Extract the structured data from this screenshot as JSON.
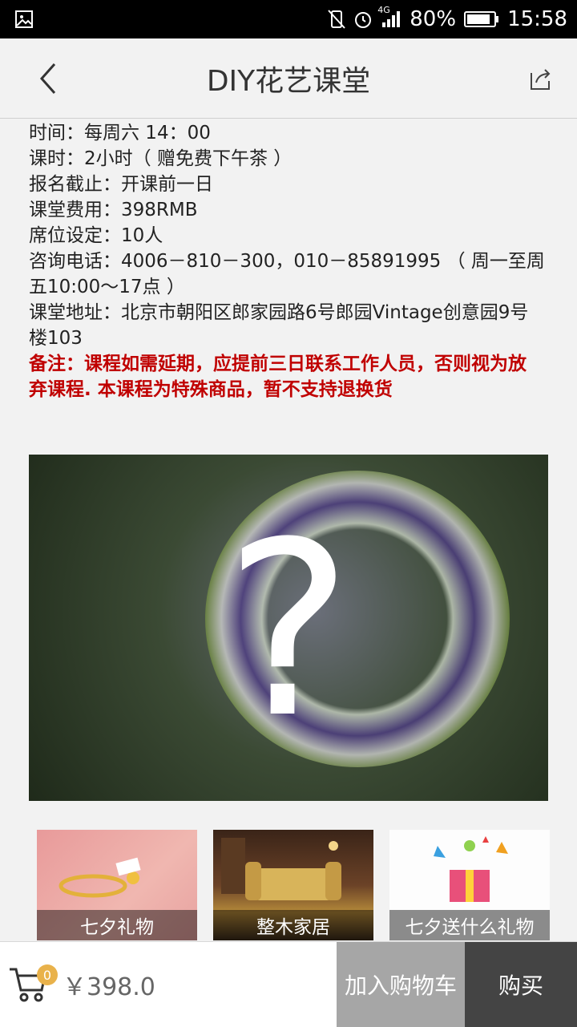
{
  "status_bar": {
    "network": "4G",
    "battery": "80%",
    "time": "15:58",
    "icons": [
      "image-icon",
      "vibrate-icon",
      "alarm-icon",
      "signal-icon",
      "battery-icon"
    ]
  },
  "header": {
    "title": "DIY花艺课堂",
    "back_icon": "back-arrow-icon",
    "share_icon": "share-icon"
  },
  "details": {
    "time": "时间：每周六 14：00",
    "duration": "课时：2小时（ 赠免费下午茶 ）",
    "deadline": "报名截止：开课前一日",
    "fee": "课堂费用：398RMB",
    "seats": "席位设定：10人",
    "phone_line1": "咨询电话：4006－810－300，010－85891995 （ 周一至周",
    "phone_line2": "五10:00～17点 ）",
    "address_line1": "课堂地址：北京市朝阳区郎家园路6号郎园Vintage创意园9号",
    "address_line2": "楼103",
    "note_line1": "备注：课程如需延期，应提前三日联系工作人员，否则视为放",
    "note_line2": "弃课程. 本课程为特殊商品，暂不支持退换货"
  },
  "hero": {
    "overlay_symbol": "?"
  },
  "related": [
    {
      "label": "七夕礼物",
      "icon": "gift-ring-image"
    },
    {
      "label": "整木家居",
      "icon": "furniture-image"
    },
    {
      "label": "七夕送什么礼物",
      "icon": "gift-box-image"
    }
  ],
  "bottom_bar": {
    "cart_count": "0",
    "price": "￥398.0",
    "add_to_cart": "加入购物车",
    "buy": "购买"
  },
  "colors": {
    "note": "#c00000",
    "add_to_cart_bg": "#a6a6a6",
    "buy_bg": "#444444",
    "badge": "#e9b24b"
  }
}
